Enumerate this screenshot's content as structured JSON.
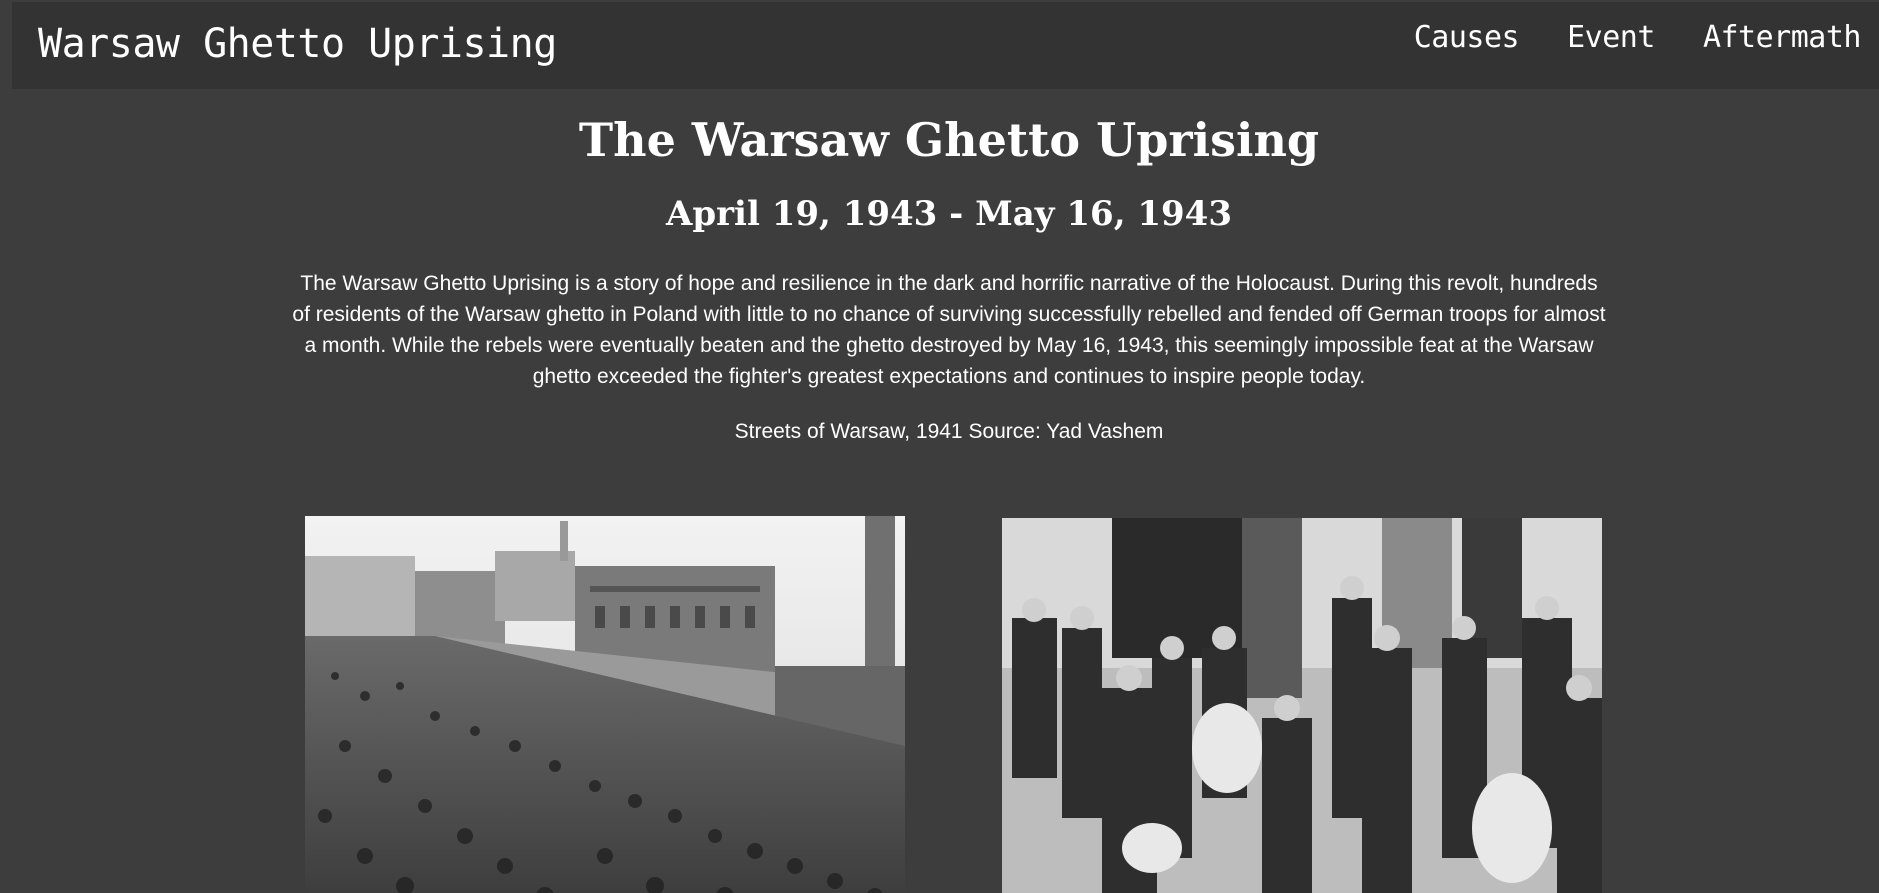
{
  "navbar": {
    "brand": "Warsaw Ghetto Uprising",
    "links": [
      {
        "label": "Causes"
      },
      {
        "label": "Event"
      },
      {
        "label": "Aftermath"
      }
    ]
  },
  "main": {
    "title": "The Warsaw Ghetto Uprising",
    "date_range": "April 19, 1943 - May 16, 1943",
    "intro": "The Warsaw Ghetto Uprising is a story of hope and resilience in the dark and horrific narrative of the Holocaust. During this revolt, hundreds of residents of the Warsaw ghetto in Poland with little to no chance of surviving successfully rebelled and fended off German troops for almost a month. While the rebels were eventually beaten and the ghetto destroyed by May 16, 1943, this seemingly impossible feat at the Warsaw ghetto exceeded the fighter's greatest expectations and continues to inspire people today.",
    "caption": "Streets of Warsaw, 1941 Source: Yad Vashem"
  },
  "colors": {
    "background": "#3d3d3d",
    "navbar": "#333333",
    "text": "#ffffff"
  }
}
